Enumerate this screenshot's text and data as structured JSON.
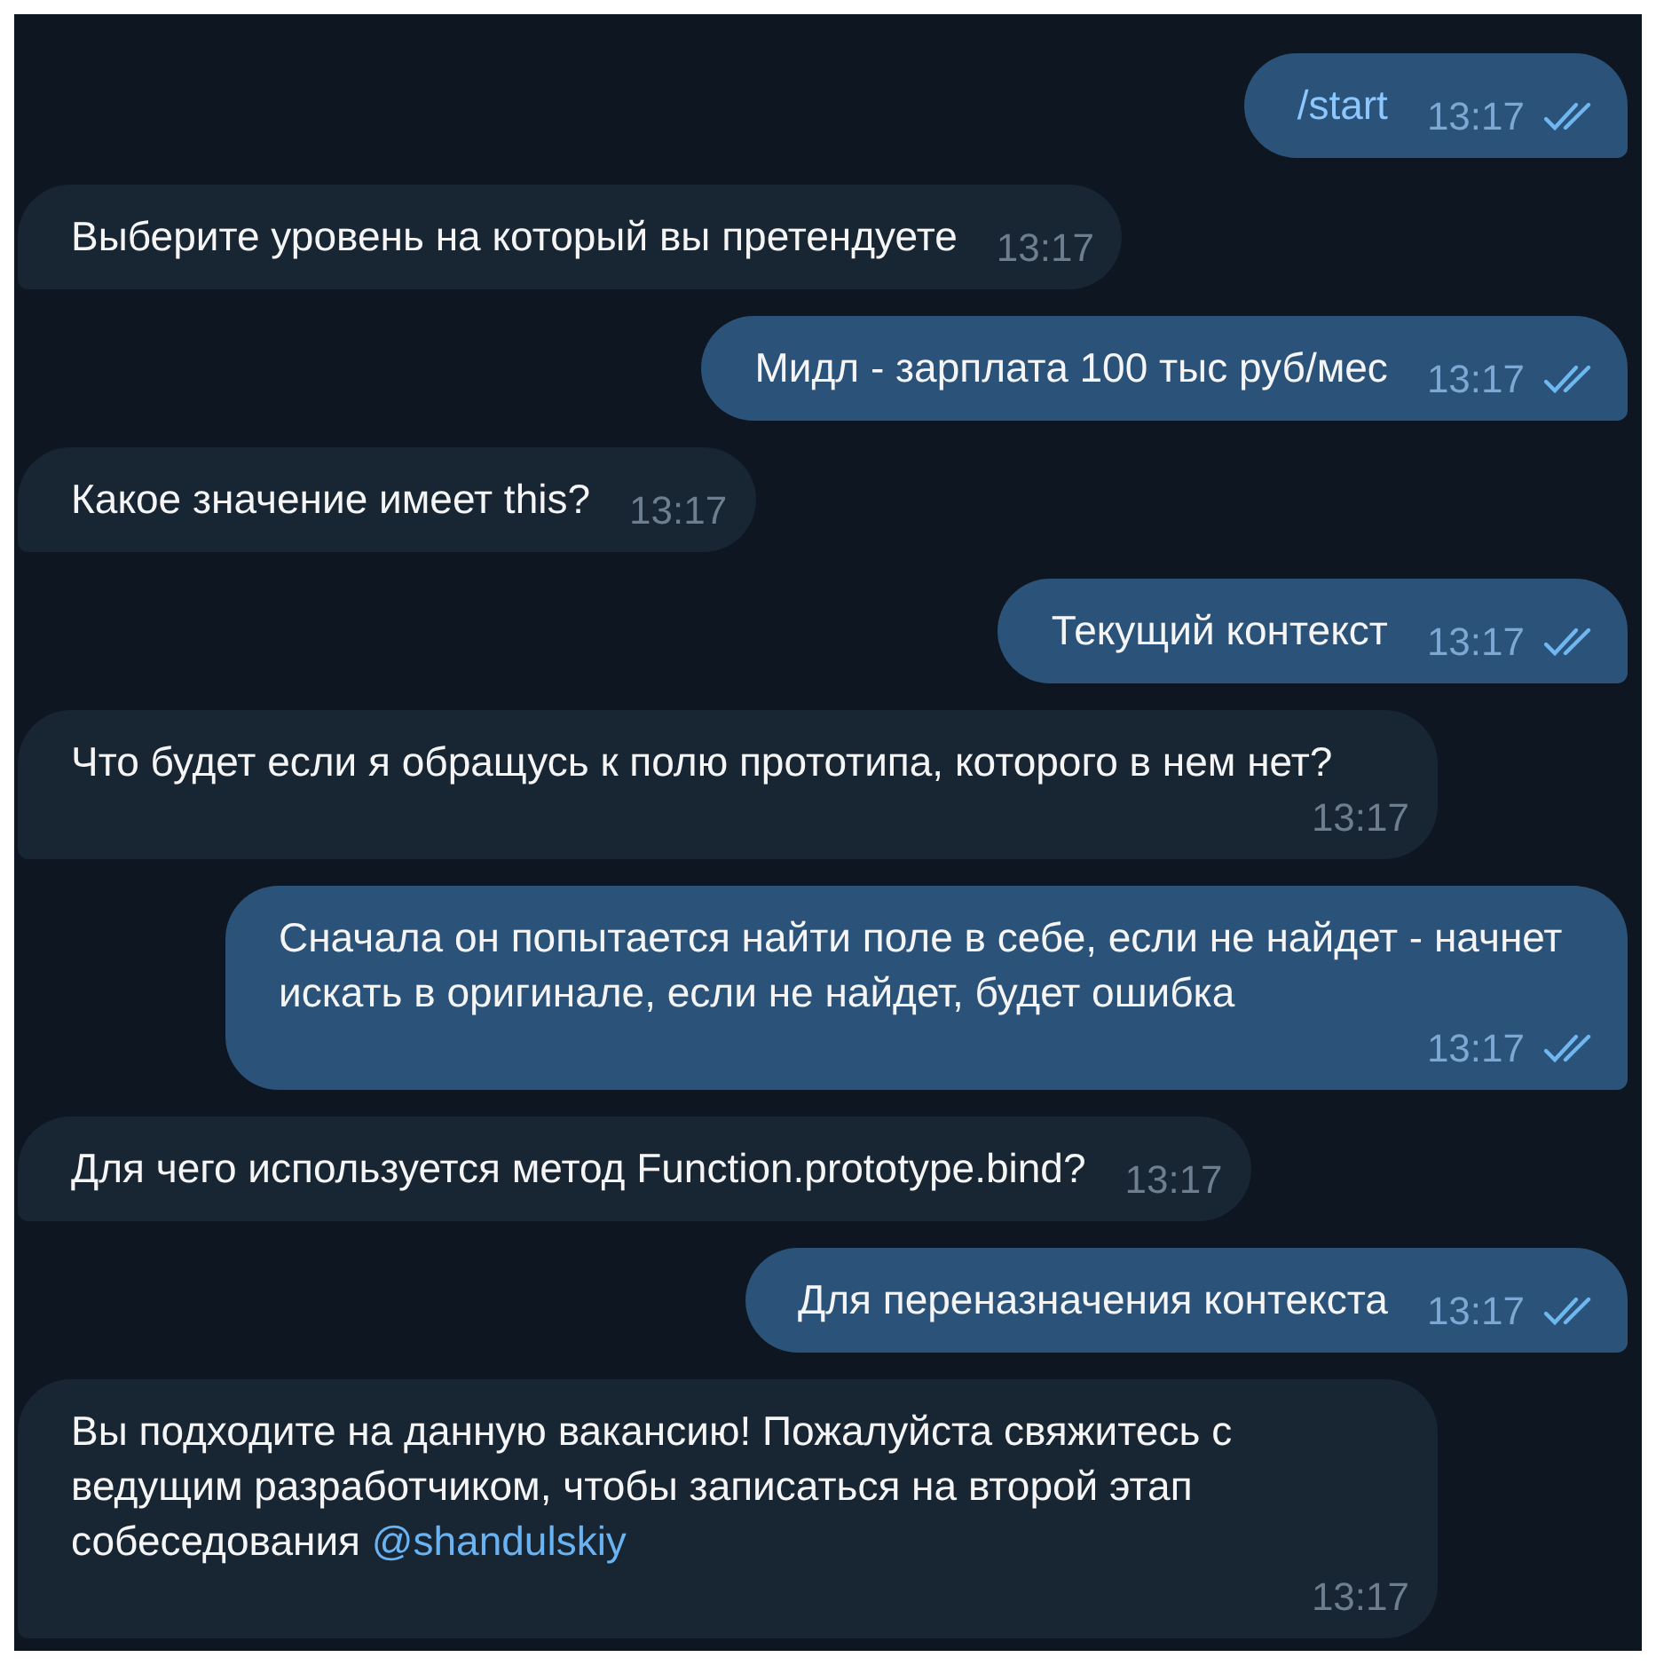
{
  "messages": [
    {
      "kind": "outgoing",
      "text": "/start",
      "time": "13:17",
      "read": true
    },
    {
      "kind": "incoming",
      "text": "Выберите уровень на который вы претендуете",
      "time": "13:17"
    },
    {
      "kind": "outgoing",
      "text": "Мидл - зарплата 100 тыс руб/мес",
      "time": "13:17",
      "read": true
    },
    {
      "kind": "incoming",
      "text": "Какое значение имеет this?",
      "time": "13:17"
    },
    {
      "kind": "outgoing",
      "text": "Текущий контекст",
      "time": "13:17",
      "read": true
    },
    {
      "kind": "incoming",
      "text": "Что будет если я обращусь к полю прототипа, которого в нем нет?",
      "time": "13:17"
    },
    {
      "kind": "outgoing",
      "text": "Сначала он попытается найти поле в себе, если не найдет - начнет искать в оригинале, если не найдет, будет ошибка",
      "time": "13:17",
      "read": true
    },
    {
      "kind": "incoming",
      "text": "Для чего используется метод Function.prototype.bind?",
      "time": "13:17"
    },
    {
      "kind": "outgoing",
      "text": "Для переназначения контекста",
      "time": "13:17",
      "read": true
    },
    {
      "kind": "incoming",
      "text": "Вы подходите на данную вакансию! Пожалуйста свяжитесь с ведущим разработчиком, чтобы записаться на второй этап собеседования ",
      "mention": "@shandulskiy",
      "time": "13:17"
    }
  ]
}
